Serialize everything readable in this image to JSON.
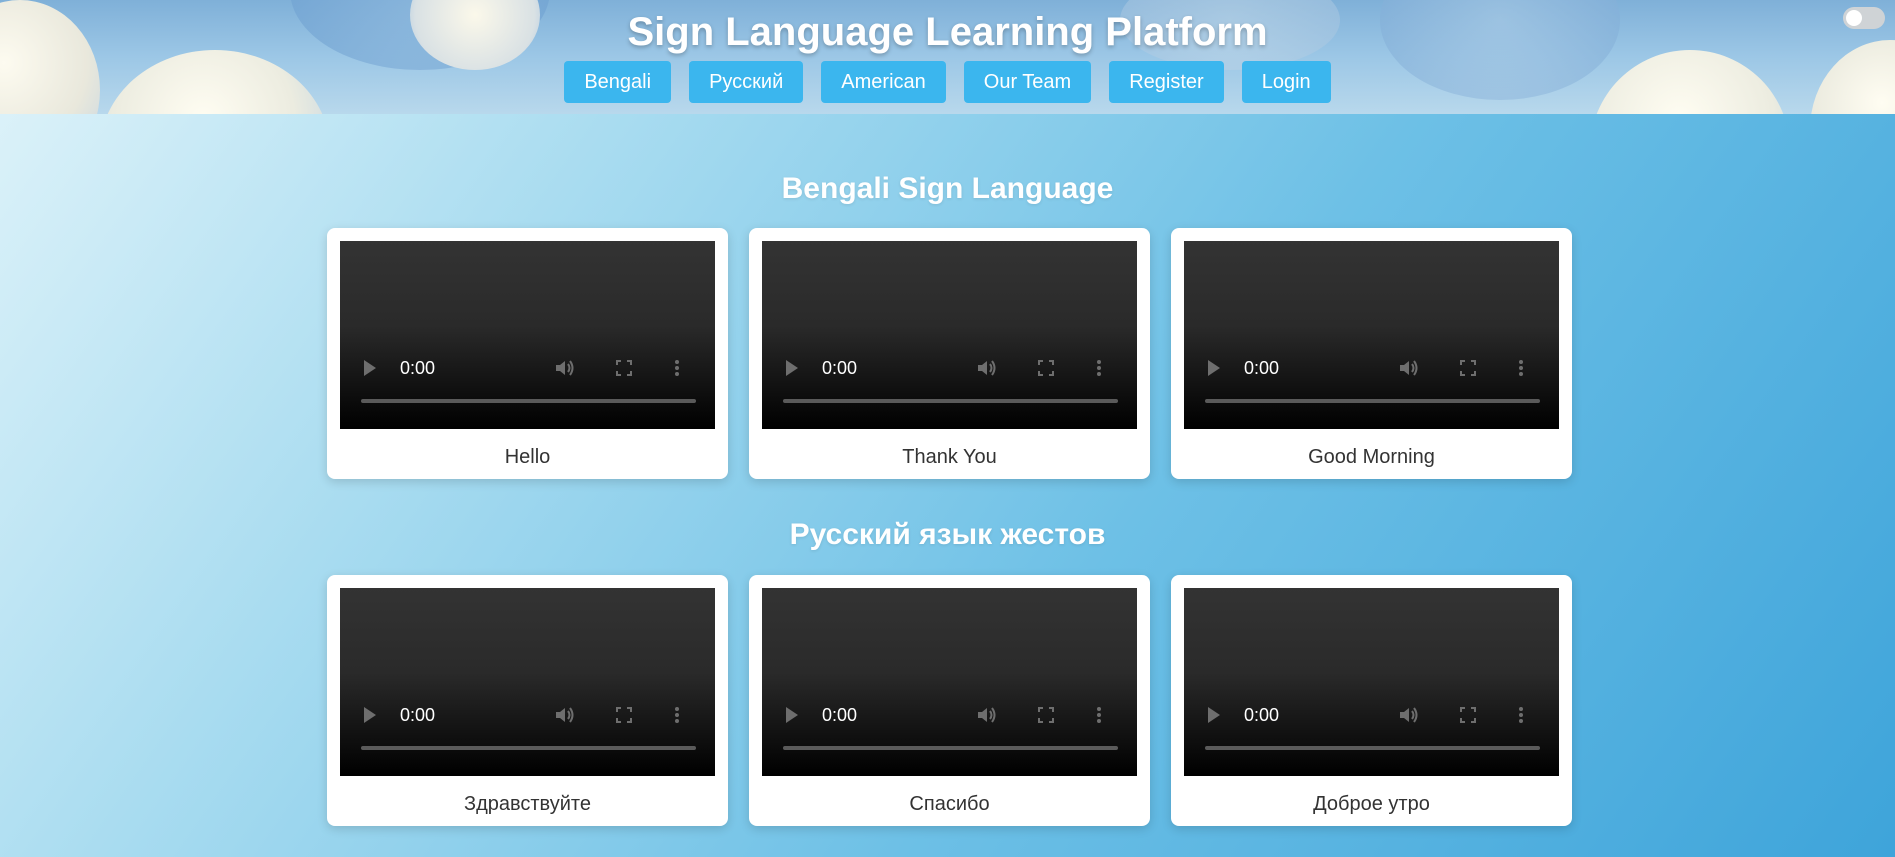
{
  "header": {
    "title": "Sign Language Learning Platform",
    "nav": [
      "Bengali",
      "Русский",
      "American",
      "Our Team",
      "Register",
      "Login"
    ]
  },
  "sections": [
    {
      "title": "Bengali Sign Language",
      "cards": [
        {
          "caption": "Hello",
          "time": "0:00"
        },
        {
          "caption": "Thank You",
          "time": "0:00"
        },
        {
          "caption": "Good Morning",
          "time": "0:00"
        }
      ]
    },
    {
      "title": "Русский язык жестов",
      "cards": [
        {
          "caption": "Здравствуйте",
          "time": "0:00"
        },
        {
          "caption": "Спасибо",
          "time": "0:00"
        },
        {
          "caption": "Доброе утро",
          "time": "0:00"
        }
      ]
    }
  ],
  "colors": {
    "nav_button": "#3bb6ee",
    "card_background": "#ffffff",
    "video_background": "#000000"
  },
  "icons": [
    "play-icon",
    "volume-icon",
    "fullscreen-icon",
    "more-options-icon",
    "theme-toggle"
  ]
}
